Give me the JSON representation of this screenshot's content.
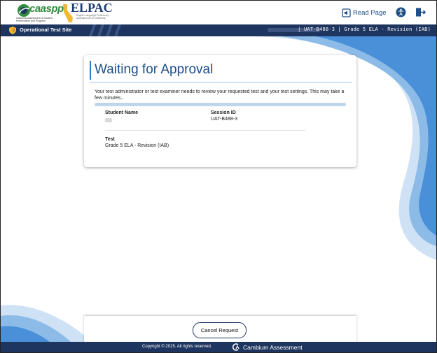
{
  "header": {
    "logo_caaspp": {
      "word": "caaspp",
      "subtitle": "California Assessment of Student Performance and Progress"
    },
    "logo_elpac": {
      "word": "ELPAC",
      "subtitle": "English Language Proficiency Assessments for California"
    },
    "read_page_label": "Read Page",
    "accessibility_icon": "accessibility-icon",
    "logout_icon": "logout-icon"
  },
  "navbar": {
    "site_label": "Operational Test Site",
    "session_info": "| UAT-B488-3 | Grade 5 ELA - Revision (IAB)"
  },
  "card": {
    "title": "Waiting for Approval",
    "message": "Your test administrator or test examiner needs to review your requested test and your test settings. This may take a few minutes..",
    "student_name_label": "Student Name",
    "session_id_label": "Session ID",
    "session_id_value": "UAT-B488-3",
    "test_label": "Test",
    "test_value": "Grade 5 ELA - Revision (IAB)"
  },
  "actions": {
    "cancel_label": "Cancel Request"
  },
  "footer": {
    "copyright": "Copyright © 2025. All rights reserved.",
    "brand": "Cambium Assessment"
  },
  "colors": {
    "navy": "#1e3560",
    "title_blue": "#1d4e89",
    "swoosh_blue": "#4a90d9"
  }
}
